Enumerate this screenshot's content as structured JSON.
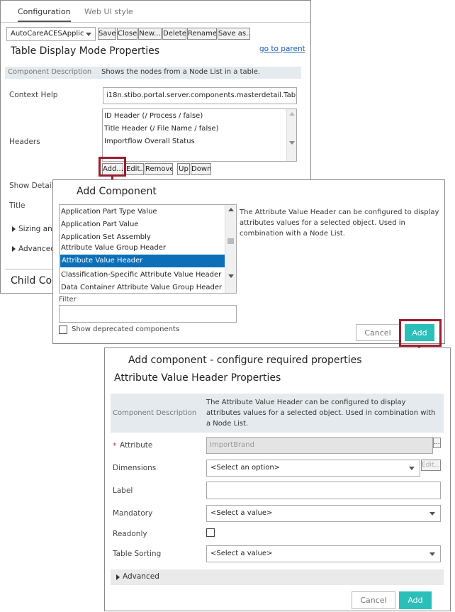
{
  "config_panel": {
    "tabs": [
      {
        "label": "Configuration"
      },
      {
        "label": "Web UI style"
      }
    ],
    "app_select": "AutoCareACESApplic",
    "toolbar": {
      "save": "Save",
      "close": "Close",
      "new": "New...",
      "delete": "Delete",
      "rename": "Rename",
      "save_as": "Save as..."
    },
    "title": "Table Display Mode Properties",
    "go_to_parent": "go to parent",
    "component_description_label": "Component Description",
    "component_description_value": "Shows the nodes from a Node List in a table.",
    "context_help_label": "Context Help",
    "context_help_value": "i18n.stibo.portal.server.components.masterdetail.Tab",
    "headers_label": "Headers",
    "headers_items": [
      "ID Header (/ Process / false)",
      "Title Header (/ File Name / false)",
      "Importflow Overall Status"
    ],
    "header_buttons": {
      "add": "Add...",
      "edit": "Edit...",
      "remove": "Remove",
      "up": "Up",
      "down": "Down"
    },
    "show_details_label": "Show Details",
    "title_label": "Title",
    "sizing_label": "Sizing and",
    "advanced_label": "Advanced",
    "child_label": "Child Co"
  },
  "add_component": {
    "title": "Add Component",
    "items": [
      "Application Part Type Value",
      "Application Part Value",
      "Application Set Assembly",
      "Attribute Value Group Header",
      "Attribute Value Header",
      "Classification-Specific Attribute Value Header",
      "Data Container Attribute Value Group Header"
    ],
    "selected_index": 4,
    "description": "The Attribute Value Header can be configured to display attributes values for a selected object. Used in combination with a Node List.",
    "filter_label": "Filter",
    "filter_value": "",
    "show_deprecated_label": "Show deprecated components",
    "cancel": "Cancel",
    "add": "Add"
  },
  "configure": {
    "title": "Add component - configure required properties",
    "subtitle": "Attribute Value Header Properties",
    "component_description_label": "Component Description",
    "component_description_value": "The Attribute Value Header can be configured to display attributes values for a selected object. Used in combination with a Node List.",
    "required_marker": "*",
    "attribute_label": "Attribute",
    "attribute_value": "ImportBrand",
    "attribute_browse": "...",
    "dimensions_label": "Dimensions",
    "dimensions_value": "<Select an option>",
    "dimensions_edit": "Edit...",
    "label_label": "Label",
    "label_value": "",
    "mandatory_label": "Mandatory",
    "mandatory_value": "<Select a value>",
    "readonly_label": "Readonly",
    "table_sorting_label": "Table Sorting",
    "table_sorting_value": "<Select a value>",
    "advanced_label": "Advanced",
    "cancel": "Cancel",
    "add": "Add"
  },
  "colors": {
    "accent": "#2bbfba",
    "highlight_arrow": "#9b1c2c",
    "selected_row": "#0d6fb8"
  }
}
